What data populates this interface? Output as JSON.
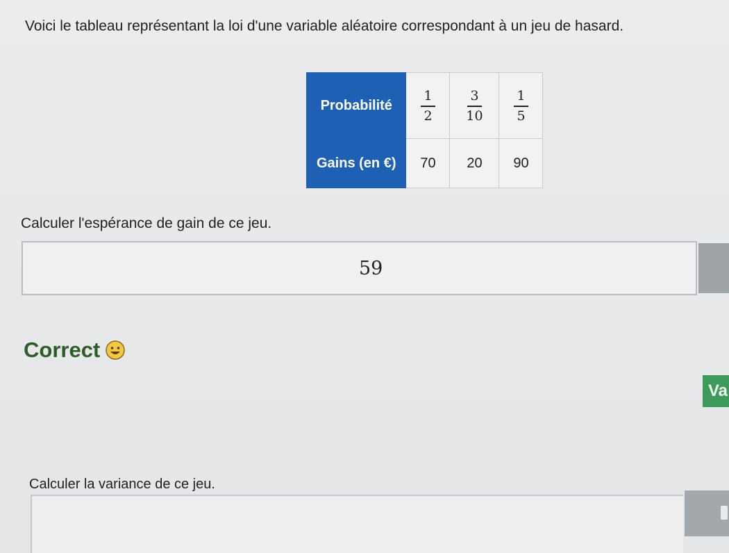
{
  "intro_text": "Voici le tableau représentant la loi d'une variable aléatoire correspondant à un jeu de hasard.",
  "table": {
    "row_headers": {
      "probability": "Probabilité",
      "gains": "Gains (en €)"
    },
    "probabilities": [
      {
        "num": "1",
        "den": "2"
      },
      {
        "num": "3",
        "den": "10"
      },
      {
        "num": "1",
        "den": "5"
      }
    ],
    "gains": [
      "70",
      "20",
      "90"
    ]
  },
  "question1": "Calculer l'espérance de gain de ce jeu.",
  "answer1": "59",
  "feedback": "Correct",
  "side_button_label": "Va",
  "question2": "Calculer la variance de ce jeu.",
  "colors": {
    "header_blue": "#1e61b4",
    "feedback_green": "#2f5b2a",
    "button_green": "#3e9a5b"
  }
}
